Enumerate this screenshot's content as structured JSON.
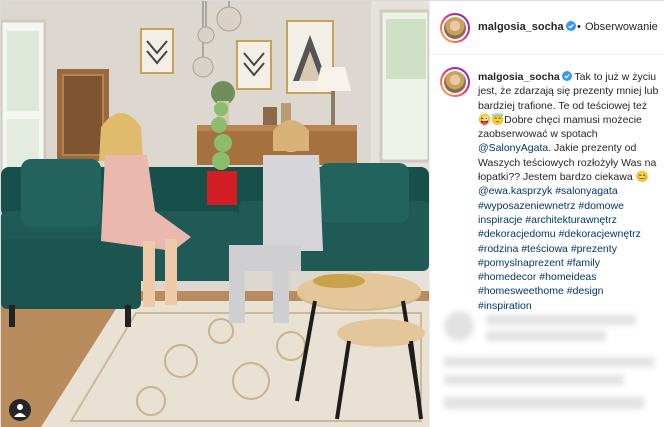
{
  "post": {
    "username": "malgosia_socha",
    "follow_label": "Obserwowanie",
    "separator": "•",
    "caption": {
      "username": "malgosia_socha",
      "text_1": " Tak to już w życiu jest, że zdarzają się prezenty mniej lub bardziej trafione. Te od teściowej też ",
      "emoji_1": "😜😇",
      "text_2": "Dobre chęci mamusi możecie zaobserwować w spotach ",
      "mention_1": "@SalonyAgata",
      "text_3": ". Jakie prezenty od Waszych teściowych rozłożyły Was na łopatki?? Jestem bardzo ciekawa ",
      "emoji_2": "😊",
      "mention_2": "@ewa.kasprzyk",
      "hashtags": [
        "#salonyagata",
        "#wyposazeniewnetrz",
        "#domowe inspiracje",
        "#architekturawnętrz",
        "#dekoracjedomu",
        "#dekoracjewnętrz",
        "#rodzina",
        "#teściowa",
        "#prezenty",
        "#pomyslnaprezent",
        "#family",
        "#homedecor",
        "#homeideas",
        "#homesweethome",
        "#design",
        "#inspiration"
      ]
    }
  },
  "colors": {
    "text": "#262626",
    "link": "#00376b",
    "border": "#dbdbdb",
    "sofa": "#1f5a55"
  },
  "icons": {
    "verified": "verified-badge-icon",
    "profile": "person-icon"
  }
}
